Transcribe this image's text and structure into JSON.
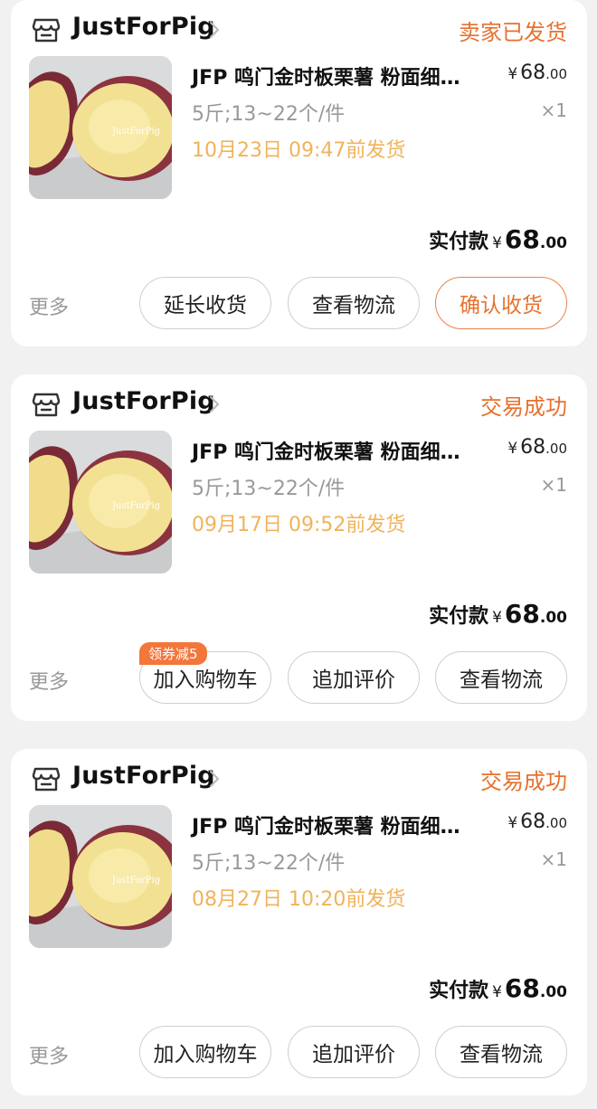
{
  "colors": {
    "accent": "#e6712e",
    "ship_date": "#f0b35a",
    "muted": "#999999",
    "coupon_bg": "#f3763b"
  },
  "orders": [
    {
      "shop_name": "JustForPig",
      "status": "卖家已发货",
      "product_title": "JFP 鸣门金时板栗薯 粉面细…",
      "watermark": "JustForPig",
      "currency": "¥",
      "unit_price_int": "68",
      "unit_price_dec": ".00",
      "spec": "5斤;13~22个/件",
      "quantity": "×1",
      "ship_text": "10月23日 09:47前发货",
      "paid_label": "实付款",
      "paid_int": "68",
      "paid_dec": ".00",
      "more": "更多",
      "buttons": [
        "延长收货",
        "查看物流",
        "确认收货"
      ]
    },
    {
      "shop_name": "JustForPig",
      "status": "交易成功",
      "product_title": "JFP 鸣门金时板栗薯 粉面细…",
      "watermark": "JustForPig",
      "currency": "¥",
      "unit_price_int": "68",
      "unit_price_dec": ".00",
      "spec": "5斤;13~22个/件",
      "quantity": "×1",
      "ship_text": "09月17日 09:52前发货",
      "paid_label": "实付款",
      "paid_int": "68",
      "paid_dec": ".00",
      "more": "更多",
      "coupon_badge": "领券减5",
      "buttons": [
        "加入购物车",
        "追加评价",
        "查看物流"
      ]
    },
    {
      "shop_name": "JustForPig",
      "status": "交易成功",
      "product_title": "JFP 鸣门金时板栗薯 粉面细…",
      "watermark": "JustForPig",
      "currency": "¥",
      "unit_price_int": "68",
      "unit_price_dec": ".00",
      "spec": "5斤;13~22个/件",
      "quantity": "×1",
      "ship_text": "08月27日 10:20前发货",
      "paid_label": "实付款",
      "paid_int": "68",
      "paid_dec": ".00",
      "more": "更多",
      "buttons": [
        "加入购物车",
        "追加评价",
        "查看物流"
      ]
    }
  ]
}
